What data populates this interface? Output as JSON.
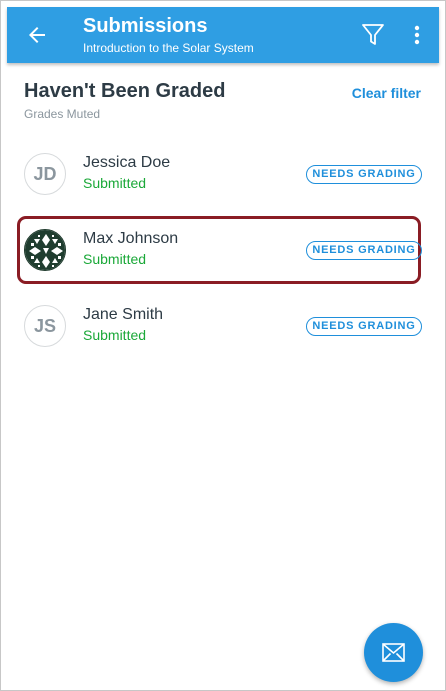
{
  "appbar": {
    "title": "Submissions",
    "subtitle": "Introduction to the Solar System",
    "back_icon": "arrow-left-icon",
    "filter_icon": "filter-icon",
    "overflow_icon": "more-vert-icon",
    "color": "#2f9ee3"
  },
  "header": {
    "title": "Haven't Been Graded",
    "subtitle": "Grades Muted",
    "clear_filter": "Clear filter"
  },
  "students": [
    {
      "initials": "JD",
      "name": "Jessica Doe",
      "status": "Submitted",
      "badge": "NEEDS GRADING",
      "avatar": "initials"
    },
    {
      "initials": "",
      "name": "Max Johnson",
      "status": "Submitted",
      "badge": "NEEDS GRADING",
      "avatar": "pattern-image",
      "highlighted": true
    },
    {
      "initials": "JS",
      "name": "Jane Smith",
      "status": "Submitted",
      "badge": "NEEDS GRADING",
      "avatar": "initials"
    }
  ],
  "fab": {
    "icon": "mail-icon"
  },
  "colors": {
    "accent": "#1f8fdb",
    "status_green": "#1aa838",
    "highlight_border": "#8a1c24"
  }
}
